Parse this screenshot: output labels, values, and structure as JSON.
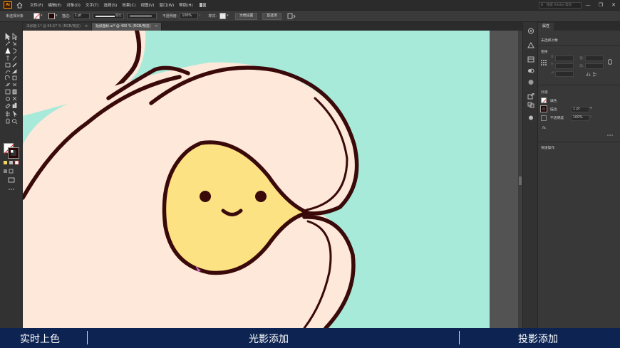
{
  "app": {
    "logo": "Ai",
    "search_placeholder": "搜索 Adobe 帮助"
  },
  "menu": [
    "文件(F)",
    "编辑(E)",
    "对象(O)",
    "文字(T)",
    "选择(S)",
    "效果(C)",
    "视图(V)",
    "窗口(W)",
    "帮助(H)"
  ],
  "window_controls": {
    "minimize": "—",
    "restore": "❐",
    "close": "✕"
  },
  "control_bar": {
    "selection": "未选择对象",
    "stroke_label": "描边:",
    "stroke_value": "1 pt",
    "stroke_profile": "等比",
    "opacity_label": "不透明度:",
    "opacity_value": "100%",
    "style_label": "样式:",
    "doc_setup": "文档设置",
    "preferences": "首选项"
  },
  "tabs": [
    {
      "label": "未标题-1* @ 66.67 % (RGB/预览)",
      "close": "×",
      "active": false
    },
    {
      "label": "贴纸图标.ai* @ 400 % (RGB/预览)",
      "close": "×",
      "active": true
    }
  ],
  "properties_panel": {
    "tab": "属性",
    "selection": "未选择对象",
    "transform": "变换",
    "x_label": "X:",
    "y_label": "Y:",
    "w_label": "宽:",
    "h_label": "高:",
    "appearance": "外观",
    "fill_label": "填色",
    "stroke_label": "描边",
    "stroke_value": "1 pt",
    "opacity_label": "不透明度",
    "opacity_value": "100%",
    "fx_label": "fx.",
    "quick_actions": "快速操作"
  },
  "colors": {
    "artboard_bg": "#a7eada",
    "hand_fill": "#fde8da",
    "outline": "#3a0a0a",
    "face_fill": "#fde283",
    "caption_bg": "#0d2452"
  },
  "captions": [
    "实时上色",
    "光影添加",
    "投影添加"
  ]
}
